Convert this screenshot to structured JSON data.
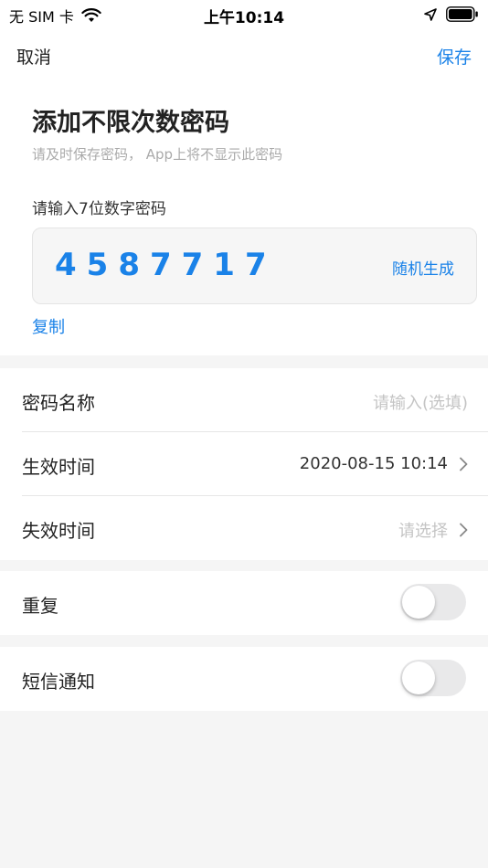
{
  "status_bar": {
    "carrier": "无 SIM 卡",
    "time": "上午10:14"
  },
  "nav": {
    "cancel_label": "取消",
    "save_label": "保存"
  },
  "header": {
    "title": "添加不限次数密码",
    "subtitle": "请及时保存密码， App上将不显示此密码"
  },
  "code": {
    "label": "请输入7位数字密码",
    "value": "4587717",
    "random_label": "随机生成",
    "copy_label": "复制"
  },
  "fields": {
    "name": {
      "label": "密码名称",
      "placeholder": "请输入(选填)"
    },
    "start": {
      "label": "生效时间",
      "value": "2020-08-15 10:14"
    },
    "end": {
      "label": "失效时间",
      "placeholder": "请选择"
    }
  },
  "repeat": {
    "label": "重复",
    "enabled": false
  },
  "sms": {
    "label": "短信通知",
    "enabled": false
  },
  "colors": {
    "accent": "#1a82e8",
    "background": "#f5f5f5",
    "placeholder": "#c4c4c4"
  },
  "icons": {
    "wifi": "wifi-icon",
    "location": "location-arrow-icon",
    "battery": "battery-icon",
    "chevron": "chevron-right-icon"
  }
}
